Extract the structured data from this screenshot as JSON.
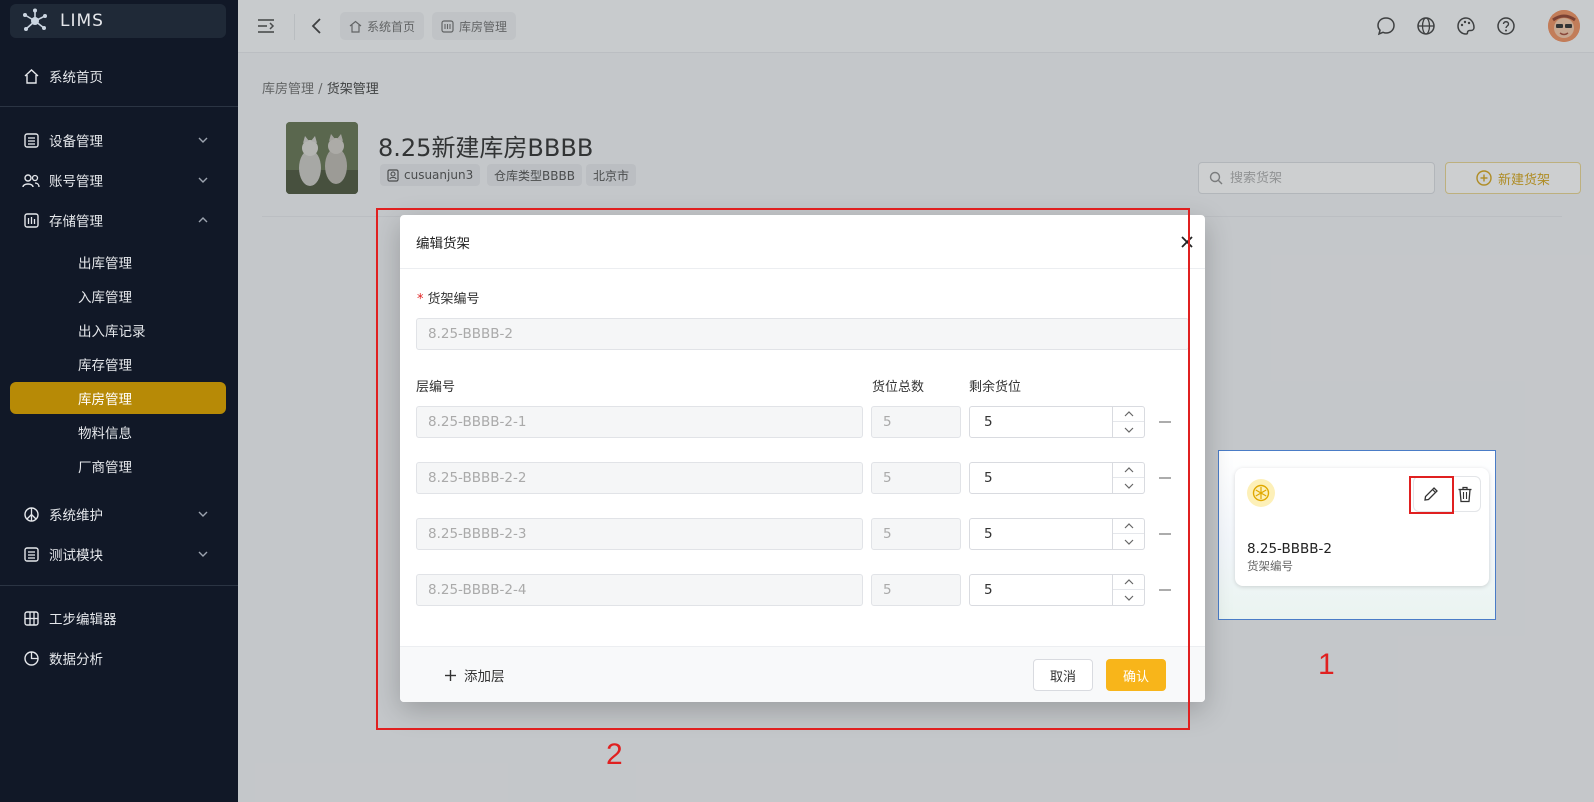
{
  "app": {
    "name": "LIMS"
  },
  "sidebar": {
    "items": [
      {
        "label": "系统首页"
      },
      {
        "label": "设备管理"
      },
      {
        "label": "账号管理"
      },
      {
        "label": "存储管理"
      },
      {
        "label": "系统维护"
      },
      {
        "label": "测试模块"
      },
      {
        "label": "工步编辑器"
      },
      {
        "label": "数据分析"
      }
    ],
    "storage_sub": [
      {
        "label": "出库管理"
      },
      {
        "label": "入库管理"
      },
      {
        "label": "出入库记录"
      },
      {
        "label": "库存管理"
      },
      {
        "label": "库房管理"
      },
      {
        "label": "物料信息"
      },
      {
        "label": "厂商管理"
      }
    ]
  },
  "topbar": {
    "tabs": [
      {
        "label": "系统首页"
      },
      {
        "label": "库房管理"
      }
    ]
  },
  "breadcrumb": {
    "parent": "库房管理",
    "sep": "/",
    "current": "货架管理"
  },
  "store": {
    "title": "8.25新建库房BBBB",
    "chips": [
      "cusuanjun3",
      "仓库类型BBBB",
      "北京市"
    ]
  },
  "toolbar": {
    "search_placeholder": "搜索货架",
    "new_label": "新建货架"
  },
  "shelf_card": {
    "code": "8.25-BBBB-2",
    "sub": "货架编号"
  },
  "annotations": {
    "mark1": "1",
    "mark2": "2"
  },
  "modal": {
    "title": "编辑货架",
    "shelf_label": "货架编号",
    "shelf_value": "8.25-BBBB-2",
    "col_layer": "层编号",
    "col_total": "货位总数",
    "col_remain": "剩余货位",
    "layers": [
      {
        "code": "8.25-BBBB-2-1",
        "total": "5",
        "remain": "5"
      },
      {
        "code": "8.25-BBBB-2-2",
        "total": "5",
        "remain": "5"
      },
      {
        "code": "8.25-BBBB-2-3",
        "total": "5",
        "remain": "5"
      },
      {
        "code": "8.25-BBBB-2-4",
        "total": "5",
        "remain": "5"
      }
    ],
    "add_layer": "添加层",
    "cancel": "取消",
    "confirm": "确认"
  },
  "colors": {
    "accent": "#f8b51a",
    "sidebar_bg": "#111827",
    "active_item": "#b78a06",
    "annotation": "#e02020"
  }
}
